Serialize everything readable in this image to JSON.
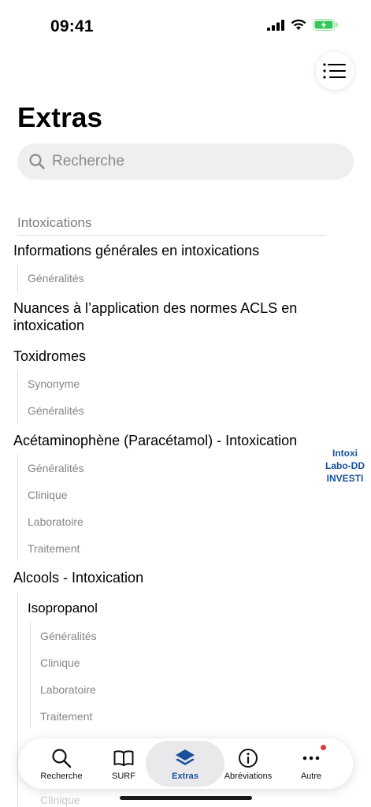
{
  "status": {
    "time": "09:41"
  },
  "page": {
    "title": "Extras",
    "search_placeholder": "Recherche"
  },
  "section": {
    "title": "Intoxications",
    "items": [
      {
        "title": "Informations générales en intoxications",
        "subs": [
          "Généralités"
        ]
      },
      {
        "title": "Nuances à l’application des normes ACLS en intoxication",
        "subs": []
      },
      {
        "title": "Toxidromes",
        "subs": [
          "Synonyme",
          "Généralités"
        ]
      },
      {
        "title": "Acétaminophène (Paracétamol) - Intoxication",
        "subs": [
          "Généralités",
          "Clinique",
          "Laboratoire",
          "Traitement"
        ]
      },
      {
        "title": "Alcools - Intoxication",
        "subgroups": [
          {
            "title": "Isopropanol",
            "subs": [
              "Généralités",
              "Clinique",
              "Laboratoire",
              "Traitement"
            ]
          }
        ]
      }
    ],
    "peek_text": "Clinique"
  },
  "side_index": [
    "Intoxi",
    "Labo-DD",
    "INVESTI"
  ],
  "tabs": [
    {
      "label": "Recherche",
      "icon": "search-icon",
      "active": false
    },
    {
      "label": "SURF",
      "icon": "book-icon",
      "active": false
    },
    {
      "label": "Extras",
      "icon": "layers-icon",
      "active": true
    },
    {
      "label": "Abréviations",
      "icon": "info-icon",
      "active": false
    },
    {
      "label": "Autre",
      "icon": "more-icon",
      "active": false,
      "badge": true
    }
  ],
  "colors": {
    "accent": "#1b4f9c",
    "badge": "#e53935"
  }
}
